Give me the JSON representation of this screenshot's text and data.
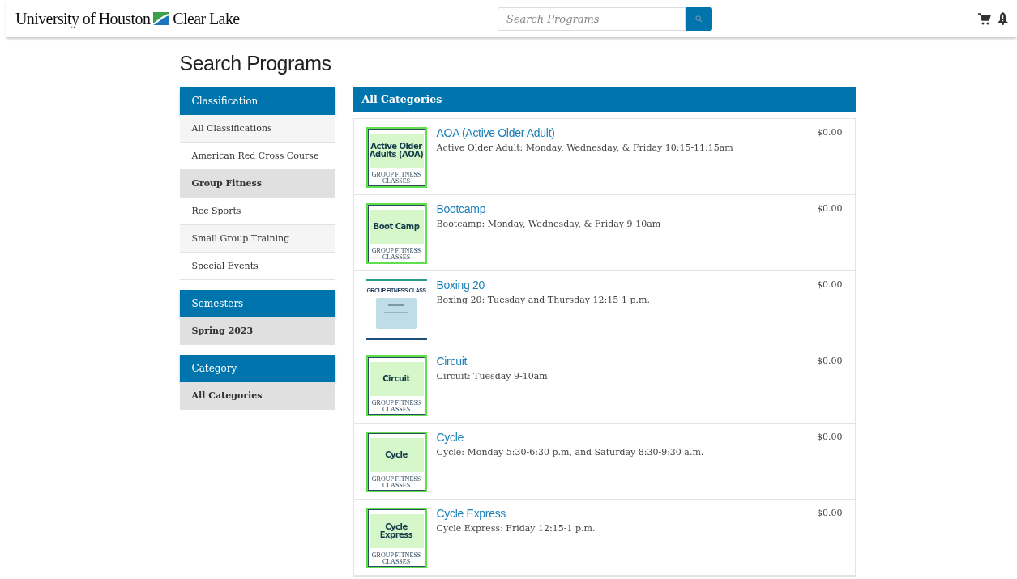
{
  "header": {
    "logo_left": "University of Houston",
    "logo_right": "Clear Lake",
    "search": {
      "placeholder": "Search Programs"
    }
  },
  "page_title": "Search Programs",
  "sidebar": [
    {
      "heading": "Classification",
      "items": [
        {
          "label": "All Classifications",
          "selected": false
        },
        {
          "label": "American Red Cross Course",
          "selected": false
        },
        {
          "label": "Group Fitness",
          "selected": true
        },
        {
          "label": "Rec Sports",
          "selected": false
        },
        {
          "label": "Small Group Training",
          "selected": false
        },
        {
          "label": "Special Events",
          "selected": false
        }
      ]
    },
    {
      "heading": "Semesters",
      "items": [
        {
          "label": "Spring 2023",
          "selected": true
        }
      ]
    },
    {
      "heading": "Category",
      "items": [
        {
          "label": "All Categories",
          "selected": true
        }
      ]
    }
  ],
  "results": {
    "heading": "All Categories",
    "programs": [
      {
        "title": "AOA (Active Older Adult)",
        "description": "Active Older Adult: Monday, Wednesday, & Friday 10:15-11:15am",
        "price": "$0.00",
        "thumb": {
          "kind": "green",
          "title": "Active Older Adults (AOA)",
          "caption": "GROUP FITNESS CLASSES"
        }
      },
      {
        "title": "Bootcamp",
        "description": "Bootcamp: Monday, Wednesday, & Friday 9-10am",
        "price": "$0.00",
        "thumb": {
          "kind": "green",
          "title": "Boot Camp",
          "caption": "GROUP FITNESS CLASSES"
        }
      },
      {
        "title": "Boxing 20",
        "description": "Boxing 20: Tuesday and Thursday 12:15-1 p.m.",
        "price": "$0.00",
        "thumb": {
          "kind": "card",
          "header": "GROUP FITNESS CLASS"
        }
      },
      {
        "title": "Circuit",
        "description": "Circuit: Tuesday 9-10am",
        "price": "$0.00",
        "thumb": {
          "kind": "green",
          "title": "Circuit",
          "caption": "GROUP FITNESS CLASSES"
        }
      },
      {
        "title": "Cycle",
        "description": "Cycle: Monday 5:30-6:30 p.m, and Saturday 8:30-9:30 a.m.",
        "price": "$0.00",
        "thumb": {
          "kind": "green",
          "title": "Cycle",
          "caption": "GROUP FITNESS CLASSES"
        }
      },
      {
        "title": "Cycle Express",
        "description": "Cycle Express: Friday 12:15-1 p.m.",
        "price": "$0.00",
        "thumb": {
          "kind": "green",
          "title": "Cycle Express",
          "caption": "GROUP FITNESS CLASSES"
        }
      }
    ]
  }
}
